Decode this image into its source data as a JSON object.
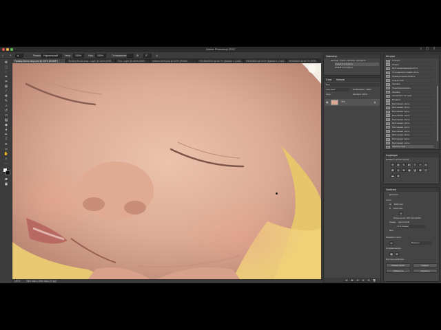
{
  "app": {
    "title": "Adobe Photoshop 2022"
  },
  "options": {
    "mode_label": "Режим:",
    "mode_value": "Нормальный",
    "opacity_label": "Непр.:",
    "opacity_value": "100%",
    "flow_label": "Наж.:",
    "flow_value": "100%",
    "smoothing_label": "Сглаживание:",
    "angle_value": "0°"
  },
  "tabs": [
    "Пример Белое лицо.psd @ 100% (RGB/8*)",
    "Пример белое лицо - Layer @ 100% (RGB...",
    "Лол - Layer @ 100% (RGB...",
    "retrieve 300% psd @ 100% (RGB/8...",
    "PSGRASE002 @ 66.7% (Кривые 1, Слой...",
    "IMG638302 @ 100% (Кривые 1, Слой...",
    "IMG638302 @ 66.7% (RGB..."
  ],
  "status": {
    "zoom": "100%",
    "doc_info": "3000 пикс x 2000 пикс (72 ppi)"
  },
  "panels": {
    "navigator": {
      "title": "Навигатор",
      "items": [
        "Автокор. тонов + автокор. контраста",
        "Новый Слой (Фон)",
        "Новый Слой (Фон)"
      ]
    },
    "layers": {
      "tabs": [
        "Слои",
        "Каналы"
      ],
      "kind_label": "Вид",
      "blend_value": "Обычные",
      "opacity_label": "Непрозрачн.:",
      "opacity_value": "100%",
      "lock_label": "Закр.:",
      "fill_label": "Заливка:",
      "fill_value": "100%",
      "layer_name": "Фон"
    },
    "history": {
      "title": "История",
      "items": [
        "Открыть",
        "Штамп",
        "Восстанавливающая кисть",
        "Точечная восстанавл. кисть",
        "Прямоугольная область",
        "Новый слой",
        "Заливка",
        "Трансформировать",
        "Заливка",
        "Копировать на слой",
        "Вставить",
        "Восстанавл. кисть",
        "Восстанавл. кисть",
        "Восстанавл. кисть",
        "Восстанавл. кисть",
        "Восстанавл. кисть",
        "Восстанавл. кисть",
        "Восстанавл. кисть",
        "Восстанавл. кисть",
        "Восстанавл. кисть",
        "Восстанавл. кисть",
        "Восстанавл. кисть",
        "Удалить слой"
      ]
    },
    "corrections": {
      "title": "Коррекция",
      "subtitle": "Добавить корректировку"
    },
    "properties": {
      "title": "Свойства",
      "doc_label": "Документ",
      "canvas_label": "Холст",
      "width_label": "Ш",
      "width_value": "3000 пикс",
      "height_label": "В",
      "height_value": "2000 пикс",
      "resolution_label": "Разрешение: 300 пикс/дюйм",
      "mode_label": "Режим",
      "mode_value": "Цвета RGB",
      "bits_value": "8 бит/канал",
      "bg_label": "Фон",
      "rulers_label": "Линейки и сетки",
      "unit_value": "Пиксели",
      "guides_label": "Направляющие",
      "quick_label": "Быстрые действия",
      "quick_btn1": "Размер изобр.",
      "quick_btn2": "Кадрир.",
      "quick_btn3": "Повернуть",
      "quick_btn4": "Отразить"
    }
  },
  "colors": {
    "panel_bg": "#444444",
    "canvas_skin": "#ddae98",
    "sweater": "#e6c56b"
  }
}
